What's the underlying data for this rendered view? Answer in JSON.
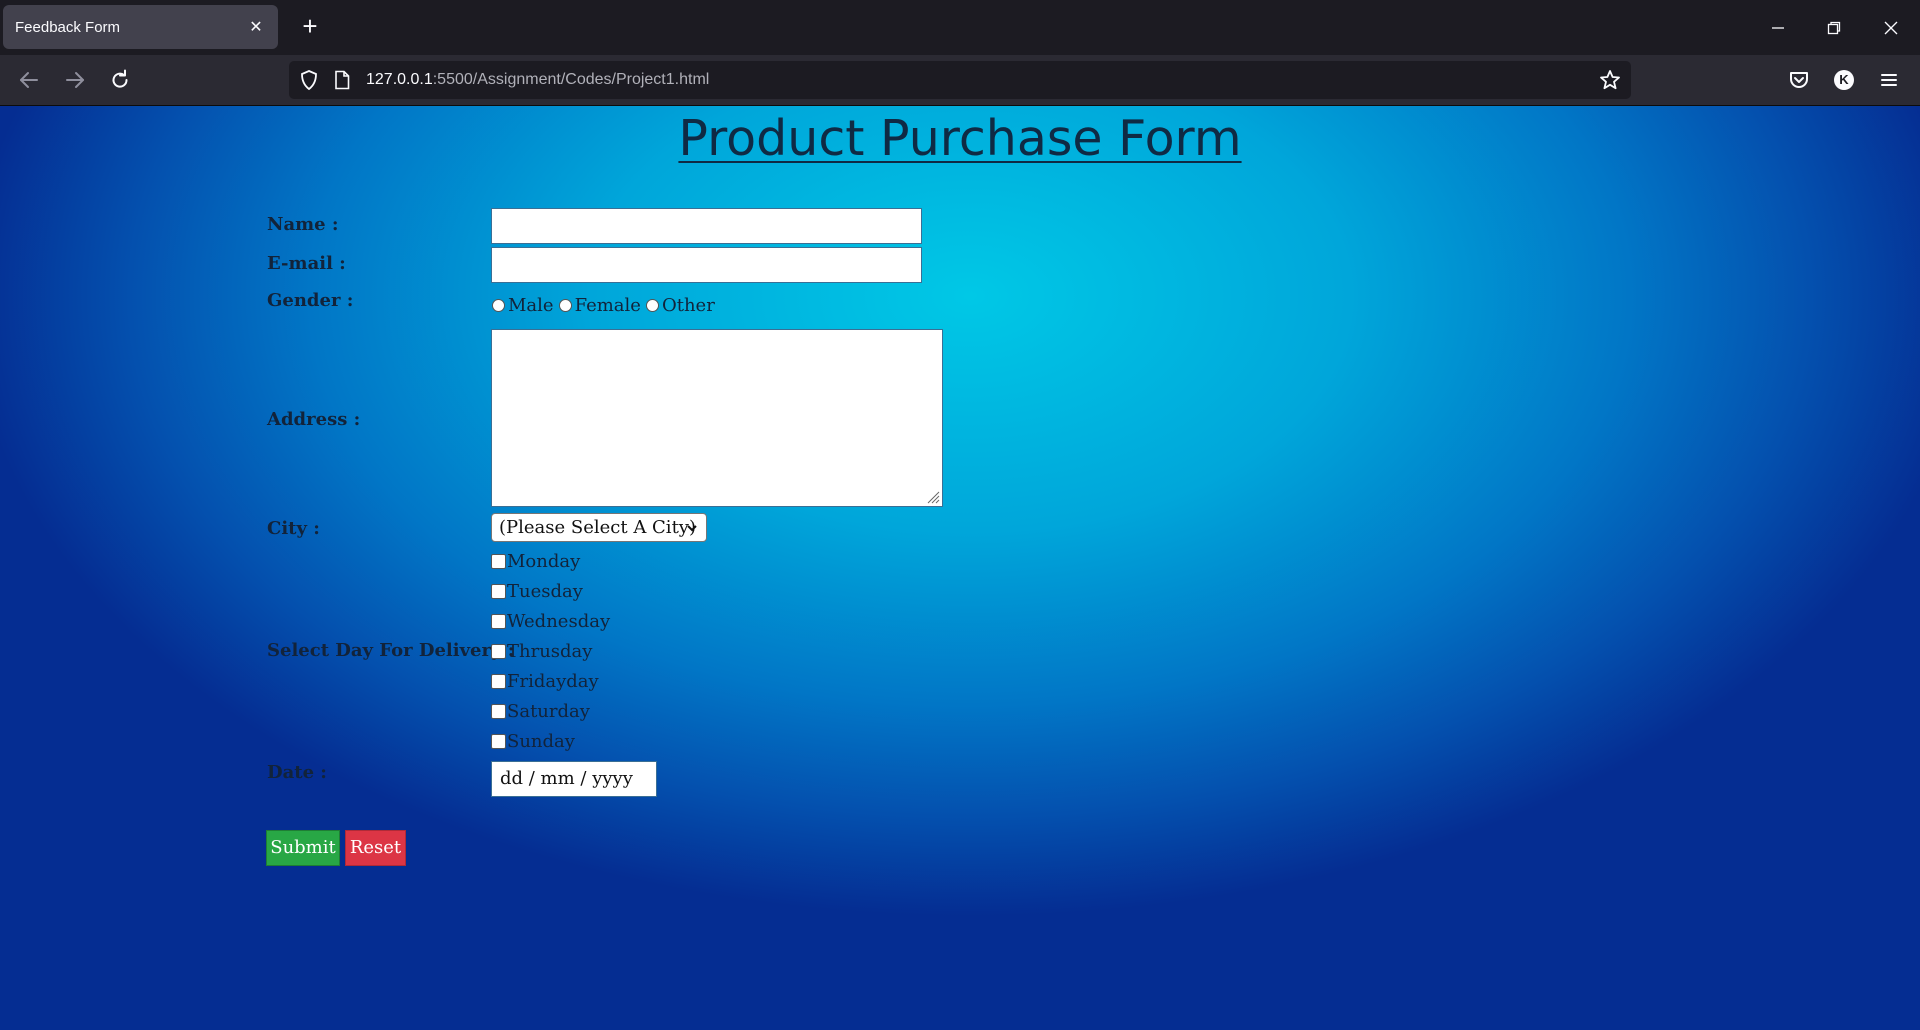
{
  "browser": {
    "tab_title": "Feedback Form",
    "tab_close": "✕",
    "new_tab": "+",
    "url_host": "127.0.0.1",
    "url_rest": ":5500/Assignment/Codes/Project1.html",
    "profile_initial": "K"
  },
  "page": {
    "title": "Product Purchase Form"
  },
  "form": {
    "name_label": "Name :",
    "email_label": "E-mail :",
    "gender_label": "Gender :",
    "gender_options": [
      "Male",
      "Female",
      "Other"
    ],
    "address_label": "Address :",
    "city_label": "City :",
    "city_selected": "(Please Select A City)",
    "delivery_label": "Select Day For Delivery :",
    "days": [
      "Monday",
      "Tuesday",
      "Wednesday",
      "Thrusday",
      "Fridayday",
      "Saturday",
      "Sunday"
    ],
    "date_label": "Date :",
    "date_placeholder": "dd / mm / yyyy",
    "submit_label": "Submit",
    "reset_label": "Reset"
  }
}
